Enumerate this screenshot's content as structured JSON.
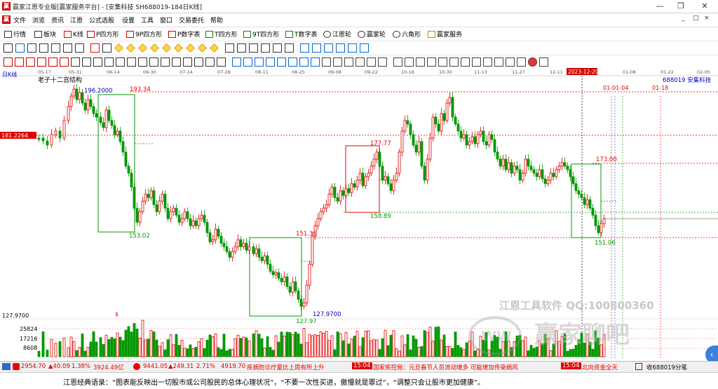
{
  "window": {
    "title": "赢家江恩专业版[赢家服务平台] - [安集科技  SH688019-184日K线]",
    "min_glyph": "—",
    "max_glyph": "❐",
    "close_glyph": "✕",
    "mdi_min": "_",
    "mdi_restore": "□",
    "mdi_close": "×",
    "logo_glyph": "赢"
  },
  "menu": [
    "文件",
    "浏览",
    "资讯",
    "江恩",
    "公式选股",
    "设置",
    "工具",
    "窗口",
    "交易委托",
    "帮助"
  ],
  "toolbar1": [
    "行情",
    "板块",
    "K线",
    "P四方形",
    "9P四方形",
    "P数字表",
    "T四方形",
    "9T四方形",
    "T数字表",
    "江恩轮",
    "赢家轮",
    "六角形",
    "赢家服务"
  ],
  "chart": {
    "period_label": "日K线",
    "indicator_label": "老子十二宫结构",
    "stock_label": "688019  安集科技",
    "y_marker": "181.2264",
    "date_marker": "2023-12-20",
    "dates_top": [
      "05-17",
      "05-31",
      "06-14",
      "06-30",
      "07-14",
      "07-28",
      "08-11",
      "08-25",
      "09-08",
      "09-22",
      "10-16",
      "10-30",
      "11-13",
      "11-27",
      "12-11",
      "01-08",
      "01-22",
      "02-05"
    ],
    "future_dates": [
      "01-01-04",
      "01-18"
    ],
    "price_labels": [
      "196.2000",
      "193.34",
      "153.02",
      "177.77",
      "158.89",
      "151.36",
      "127.97",
      "127.9700",
      "173.00",
      "151.06"
    ],
    "vol_axis": [
      "127.9700",
      "25824",
      "17216",
      "8608"
    ],
    "dollar_mark": "$",
    "watermark1": "江恩工具软件  QQ:100800360",
    "watermark2": "赢家聊吧",
    "accent_red": "#e00000",
    "accent_green": "#009900"
  },
  "chart_data": {
    "type": "candlestick",
    "title": "老子十二宫结构",
    "symbol": "688019 安集科技",
    "period": "日K线",
    "key_prices": {
      "high": 196.2,
      "low": 127.97,
      "current_marker": 181.2264
    },
    "annotated_levels": [
      193.34,
      153.02,
      177.77,
      158.89,
      151.36,
      127.97,
      173.0,
      151.06
    ],
    "x_dates": [
      "05-17",
      "05-31",
      "06-14",
      "06-30",
      "07-14",
      "07-28",
      "08-11",
      "08-25",
      "09-08",
      "09-22",
      "10-16",
      "10-30",
      "11-13",
      "11-27",
      "12-11",
      "01-08",
      "01-22",
      "02-05"
    ],
    "volume_ticks": [
      25824,
      17216,
      8608
    ],
    "grid": false
  },
  "status": {
    "sh_value": "2954.70",
    "sh_change": "▲40.09",
    "sh_pct": "1.38%",
    "sh_amount": "3924.49亿",
    "sz_value": "9441.05",
    "sz_change": "▲249.31",
    "sz_pct": "2.71%",
    "sz_amount": "4919.70",
    "news1": "疾病防诊疗量比上周有所上升",
    "time1": "15:04",
    "news2": "国家疾控局：元旦春节人员流动增多 可能增加传染病风",
    "time2": "15:04",
    "news3": "北向资金全天",
    "right": "收688019分笔"
  },
  "footer": {
    "quote": "江恩经典语录：“图表能反映出一切股市或公司股民的总体心理状况”，“不要一次性买进，傲慢就是罪过”，“调整只会让股市更加健康”。"
  },
  "side_button": "‹"
}
